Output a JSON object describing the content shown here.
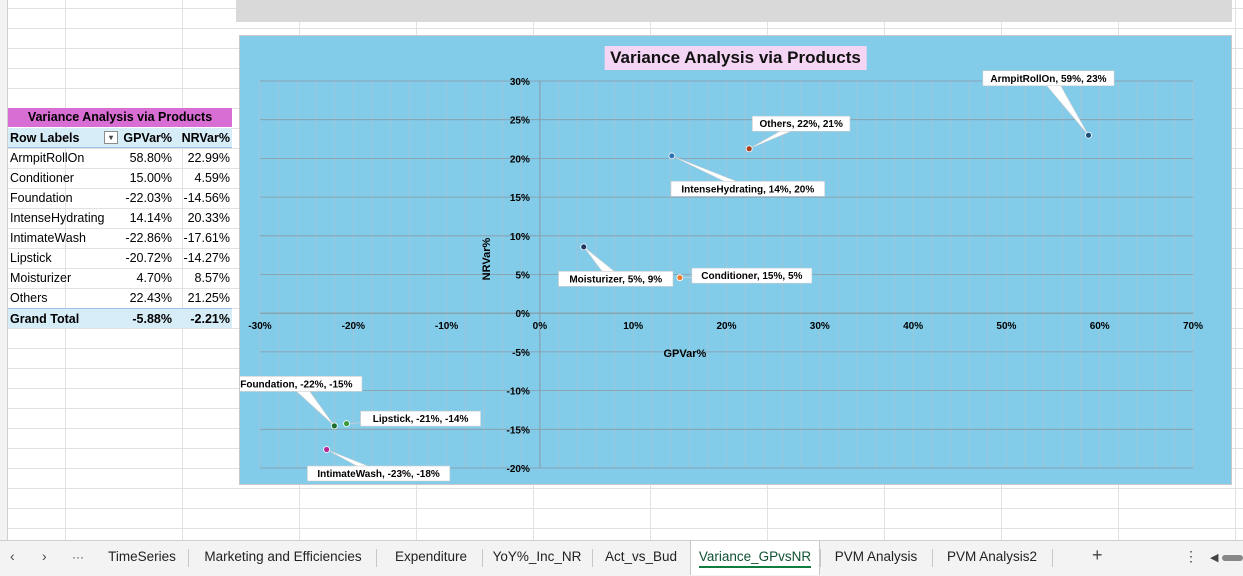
{
  "pivot": {
    "title": "Variance Analysis via Products",
    "headers": {
      "label": "Row Labels",
      "gp": "GPVar%",
      "nr": "NRVar%",
      "filter_icon": "▾"
    },
    "rows": [
      {
        "label": "ArmpitRollOn",
        "gp": "58.80%",
        "nr": "22.99%"
      },
      {
        "label": "Conditioner",
        "gp": "15.00%",
        "nr": "4.59%"
      },
      {
        "label": "Foundation",
        "gp": "-22.03%",
        "nr": "-14.56%"
      },
      {
        "label": "IntenseHydrating",
        "gp": "14.14%",
        "nr": "20.33%"
      },
      {
        "label": "IntimateWash",
        "gp": "-22.86%",
        "nr": "-17.61%"
      },
      {
        "label": "Lipstick",
        "gp": "-20.72%",
        "nr": "-14.27%"
      },
      {
        "label": "Moisturizer",
        "gp": "4.70%",
        "nr": "8.57%"
      },
      {
        "label": "Others",
        "gp": "22.43%",
        "nr": "21.25%"
      }
    ],
    "total": {
      "label": "Grand Total",
      "gp": "-5.88%",
      "nr": "-2.21%"
    }
  },
  "chart_data": {
    "type": "scatter",
    "title": "Variance Analysis via Products",
    "xlabel": "GPVar%",
    "ylabel": "NRVar%",
    "xlim": [
      -30,
      70
    ],
    "ylim": [
      -20,
      30
    ],
    "x_ticks": [
      "-30%",
      "-20%",
      "-10%",
      "0%",
      "10%",
      "20%",
      "30%",
      "40%",
      "50%",
      "60%",
      "70%"
    ],
    "y_ticks": [
      "-20%",
      "-15%",
      "-10%",
      "-5%",
      "0%",
      "5%",
      "10%",
      "15%",
      "20%",
      "25%",
      "30%"
    ],
    "grid": true,
    "background_color": "#82cbe9",
    "points": [
      {
        "name": "ArmpitRollOn",
        "x": 58.8,
        "y": 22.99,
        "label": "ArmpitRollOn, 59%, 23%",
        "color": "#1f4e79"
      },
      {
        "name": "Conditioner",
        "x": 15.0,
        "y": 4.59,
        "label": "Conditioner, 15%, 5%",
        "color": "#ed7d31"
      },
      {
        "name": "Foundation",
        "x": -22.03,
        "y": -14.56,
        "label": "Foundation, -22%, -15%",
        "color": "#1e6b2e"
      },
      {
        "name": "IntenseHydrating",
        "x": 14.14,
        "y": 20.33,
        "label": "IntenseHydrating, 14%, 20%",
        "color": "#2e75b6"
      },
      {
        "name": "IntimateWash",
        "x": -22.86,
        "y": -17.61,
        "label": "IntimateWash, -23%, -18%",
        "color": "#b4279a"
      },
      {
        "name": "Lipstick",
        "x": -20.72,
        "y": -14.27,
        "label": "Lipstick, -21%, -14%",
        "color": "#3a9a3a"
      },
      {
        "name": "Moisturizer",
        "x": 4.7,
        "y": 8.57,
        "label": "Moisturizer, 5%, 9%",
        "color": "#203864"
      },
      {
        "name": "Others",
        "x": 22.43,
        "y": 21.25,
        "label": "Others, 22%, 21%",
        "color": "#a9401c"
      }
    ]
  },
  "tabs": {
    "nav_prev": "‹",
    "nav_next": "›",
    "nav_more": "···",
    "items": [
      "TimeSeries",
      "Marketing and Efficiencies",
      "Expenditure",
      "YoY%_Inc_NR",
      "Act_vs_Bud",
      "Variance_GPvsNR",
      "PVM Analysis",
      "PVM Analysis2"
    ],
    "active": "Variance_GPvsNR",
    "add": "+",
    "options": "⋮",
    "scroll_left": "◀"
  }
}
